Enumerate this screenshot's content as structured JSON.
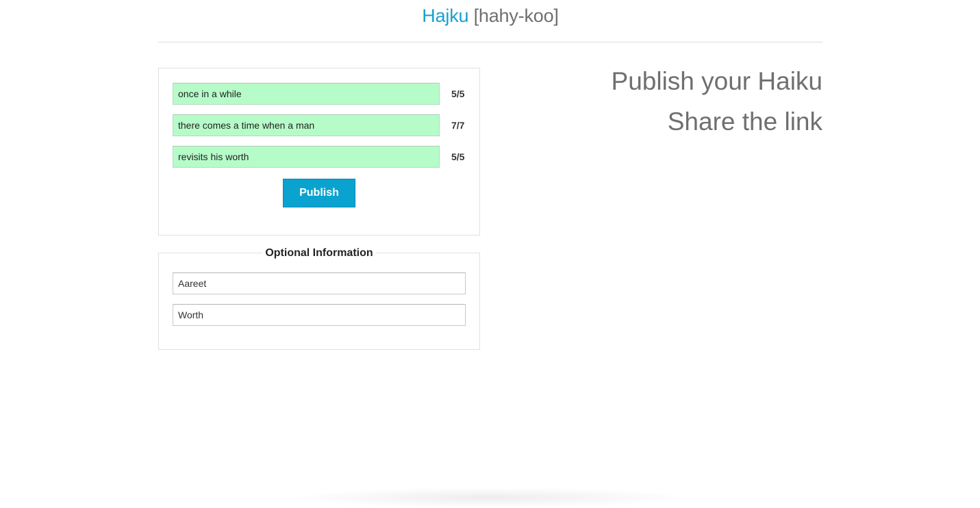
{
  "header": {
    "brand": "Hajku",
    "pronunciation": "[hahy-koo]"
  },
  "haiku": {
    "lines": [
      {
        "text": "once in a while",
        "count": "5/5"
      },
      {
        "text": "there comes a time when a man",
        "count": "7/7"
      },
      {
        "text": "revisits his worth",
        "count": "5/5"
      }
    ],
    "publish_label": "Publish"
  },
  "optional": {
    "legend": "Optional Information",
    "first_name": "Aareet",
    "last_name": "Worth"
  },
  "taglines": {
    "line1": "Publish your Haiku",
    "line2": "Share the link"
  },
  "colors": {
    "brand": "#1a9fd1",
    "valid_line_bg": "#b6fcc9",
    "button": "#0aa3cf"
  }
}
